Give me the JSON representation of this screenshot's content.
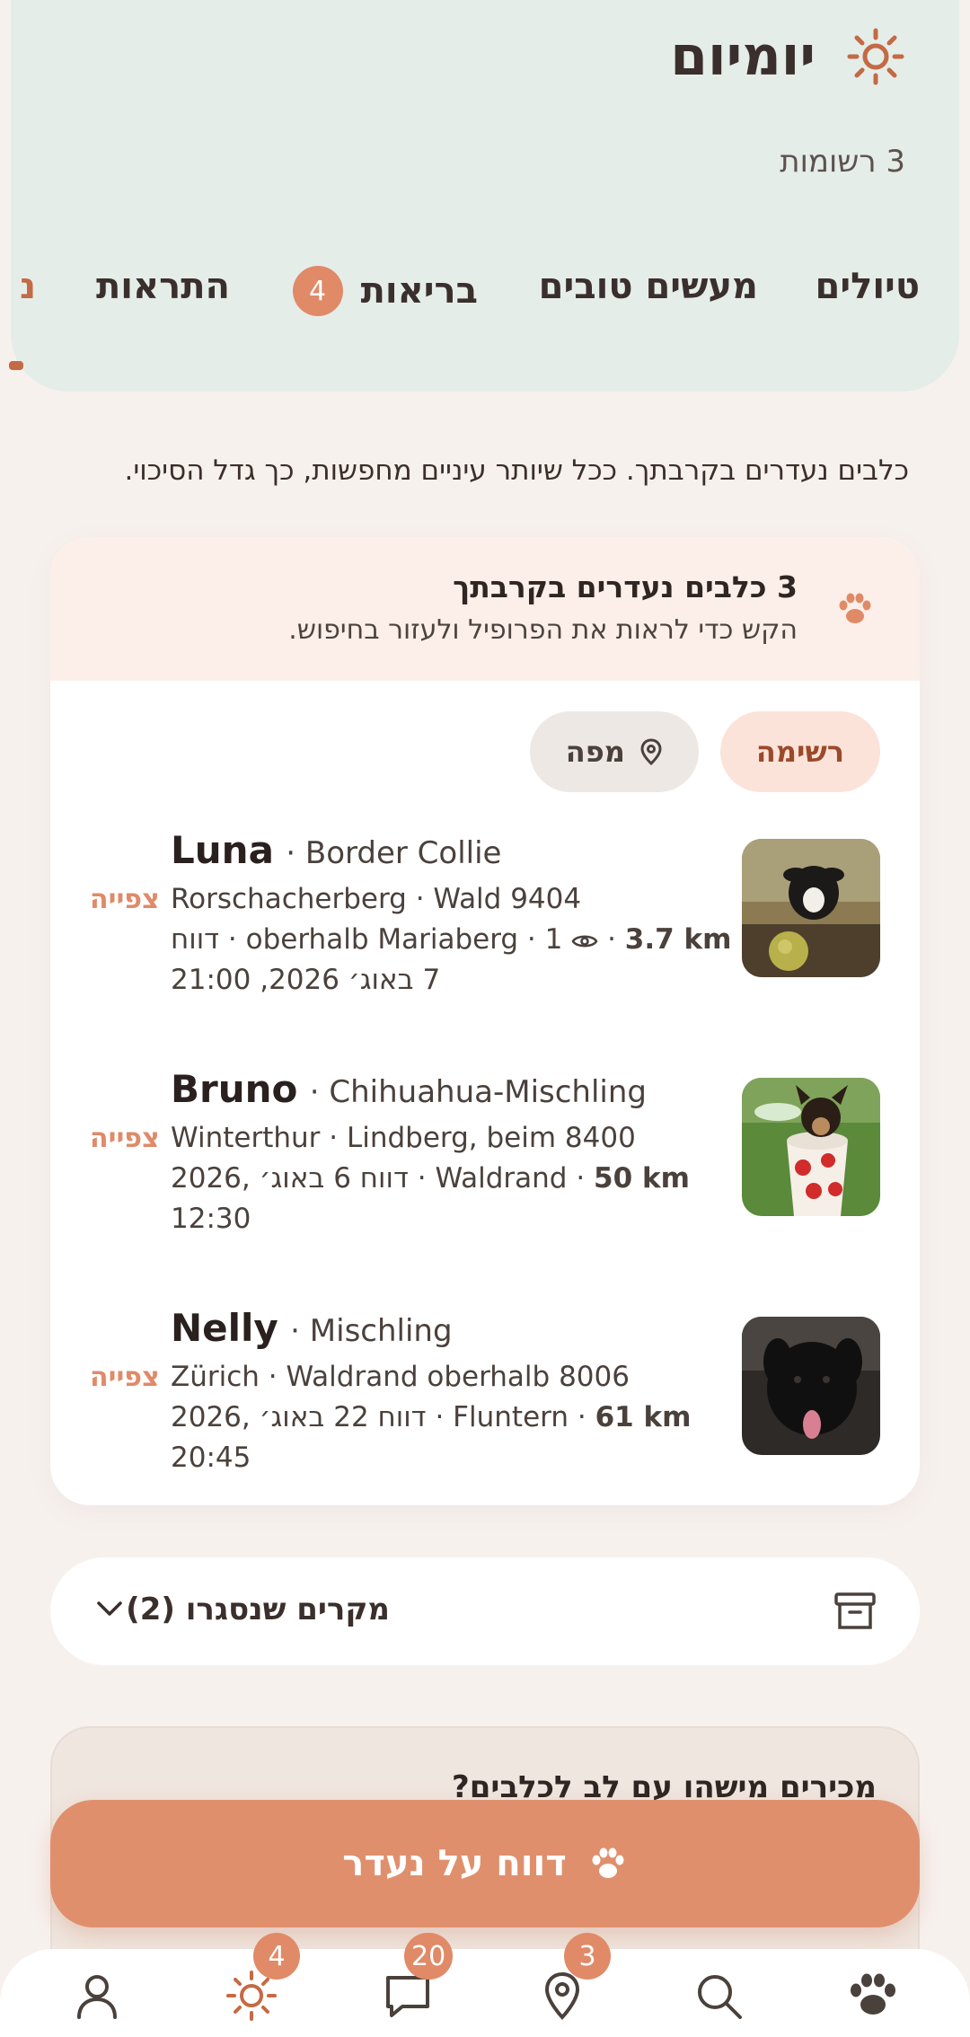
{
  "header": {
    "title": "יומיום",
    "subtitle": "3 רשומות",
    "tabs": [
      {
        "label": "טיולים"
      },
      {
        "label": "מעשים טובים"
      },
      {
        "label": "בריאות",
        "badge": "4"
      },
      {
        "label": "התראות"
      },
      {
        "label": "נ"
      }
    ]
  },
  "intro_text": "כלבים נעדרים בקרבתך. ככל שיותר עיניים מחפשות, כך גדל הסיכוי.",
  "missing_card": {
    "title": "3 כלבים נעדרים בקרבתך",
    "subtitle": "הקש כדי לראות את הפרופיל ולעזור בחיפוש.",
    "toggle_list": "רשימה",
    "toggle_map": "מפה",
    "dogs": [
      {
        "name": "Luna",
        "breed": "· Border Collie",
        "location": "Rorschacherberg · Wald 9404",
        "meta_pre": "דווח · oberhalb Mariaberg · 1",
        "distance": "3.7 km",
        "date": "7 באוג׳ 2026, 21:00",
        "view": "צפייה"
      },
      {
        "name": "Bruno",
        "breed": "· Chihuahua-Mischling",
        "location": "Winterthur · Lindberg, beim 8400",
        "meta_pre": "2026, דווח 6 באוג׳ · Waldrand ·",
        "distance": "50 km",
        "date": "12:30",
        "view": "צפייה"
      },
      {
        "name": "Nelly",
        "breed": "· Mischling",
        "location": "Zürich · Waldrand oberhalb 8006",
        "meta_pre": "2026, דווח 22 באוג׳ · Fluntern ·",
        "distance": "61 km",
        "date": "20:45",
        "view": "צפייה"
      }
    ]
  },
  "closed_cases": {
    "label": "מקרים שנסגרו (2)"
  },
  "promo": {
    "title": "מכירים מישהו עם לב לכלבים?"
  },
  "fab": {
    "label": "דווח על נעדר"
  },
  "bottom_nav": {
    "badges": {
      "daily": "4",
      "messages": "20",
      "missing": "3"
    }
  },
  "colors": {
    "accent": "#e08a68",
    "header_bg": "#e5ede9",
    "card_head_bg": "#fcefe9"
  }
}
